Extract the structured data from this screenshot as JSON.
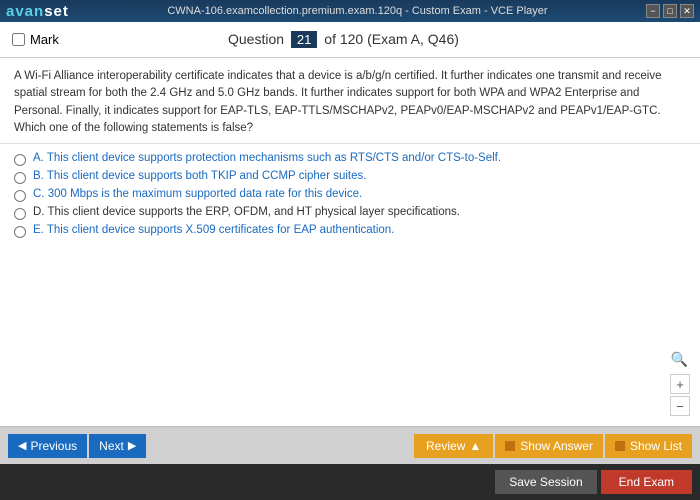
{
  "titlebar": {
    "logo": "avanset",
    "title": "CWNA-106.examcollection.premium.exam.120q - Custom Exam - VCE Player",
    "controls": [
      "−",
      "□",
      "✕"
    ]
  },
  "header": {
    "mark_label": "Mark",
    "question_label": "Question",
    "question_number": "21",
    "question_total": "of 120 (Exam A, Q46)"
  },
  "question": {
    "text": "A Wi-Fi Alliance interoperability certificate indicates that a device is a/b/g/n certified. It further indicates one transmit and receive spatial stream for both the 2.4 GHz and 5.0 GHz bands. It further indicates support for both WPA and WPA2 Enterprise and Personal. Finally, it indicates support for EAP-TLS, EAP-TTLS/MSCHAPv2, PEAPv0/EAP-MSCHAPv2 and PEAPv1/EAP-GTC. Which one of the following statements is false?"
  },
  "answers": [
    {
      "id": "A",
      "text": "A. This client device supports protection mechanisms such as RTS/CTS and/or CTS-to-Self.",
      "highlighted": true
    },
    {
      "id": "B",
      "text": "B. This client device supports both TKIP and CCMP cipher suites.",
      "highlighted": true
    },
    {
      "id": "C",
      "text": "C. 300 Mbps is the maximum supported data rate for this device.",
      "highlighted": true
    },
    {
      "id": "D",
      "text": "D. This client device supports the ERP, OFDM, and HT physical layer specifications.",
      "highlighted": false
    },
    {
      "id": "E",
      "text": "E. This client device supports X.509 certificates for EAP authentication.",
      "highlighted": true
    }
  ],
  "nav": {
    "previous_label": "Previous",
    "next_label": "Next",
    "review_label": "Review",
    "show_answer_label": "Show Answer",
    "show_list_label": "Show List"
  },
  "bottom": {
    "save_session_label": "Save Session",
    "end_exam_label": "End Exam"
  }
}
